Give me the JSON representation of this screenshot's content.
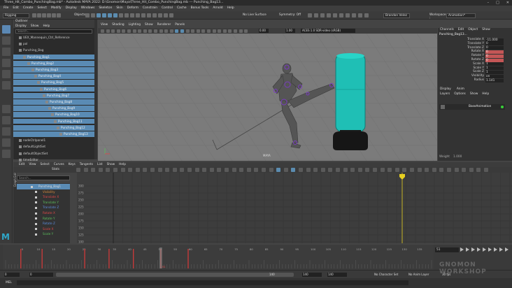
{
  "window": {
    "title": "Three_Hit_Combo_PunchingBag.mb* - Autodesk MAYA 2022: D:\\Gnomon\\Maya\\Three_Hit_Combo_PunchingBag.mb  ---  Punching_Bag13...",
    "buttons": [
      "–",
      "□",
      "✕"
    ]
  },
  "menubar": [
    "File",
    "Edit",
    "Create",
    "Select",
    "Modify",
    "Display",
    "Windows",
    "Skeleton",
    "Skin",
    "Deform",
    "Constrain",
    "Control",
    "Cache",
    "Bonus Tools",
    "Arnold",
    "Help"
  ],
  "statusline": {
    "mode": "Rigging",
    "objects_label": "Objects",
    "live_surface": "No Live Surface",
    "symmetry": "Symmetry: Off",
    "user": "Brandon Velez",
    "workspace_label": "Workspace :",
    "workspace": "Animation*"
  },
  "outliner": {
    "title": "Outliner",
    "menu": [
      "Display",
      "Show",
      "Help"
    ],
    "search_placeholder": "Search...",
    "rows": [
      {
        "label": "UEX_Mannequin_Ctrl_Reference",
        "indent": 8,
        "sel": false
      },
      {
        "label": "pol",
        "indent": 8,
        "sel": false
      },
      {
        "label": "Punching_Bag",
        "indent": 8,
        "sel": false
      },
      {
        "label": "Punching_Bag1",
        "indent": 14,
        "sel": true
      },
      {
        "label": "Punching_Bag2",
        "indent": 20,
        "sel": true
      },
      {
        "label": "Punching_Bag3",
        "indent": 26,
        "sel": true
      },
      {
        "label": "Punching_Bag4",
        "indent": 30,
        "sel": true
      },
      {
        "label": "Punching_Bag5",
        "indent": 34,
        "sel": true
      },
      {
        "label": "Punching_Bag6",
        "indent": 38,
        "sel": true
      },
      {
        "label": "Punching_Bag7",
        "indent": 42,
        "sel": true
      },
      {
        "label": "Punching_Bag8",
        "indent": 46,
        "sel": true
      },
      {
        "label": "Punching_Bag9",
        "indent": 50,
        "sel": true
      },
      {
        "label": "Punching_Bag10",
        "indent": 54,
        "sel": true
      },
      {
        "label": "Punching_Bag11",
        "indent": 58,
        "sel": true
      },
      {
        "label": "Punching_Bag12",
        "indent": 62,
        "sel": true
      },
      {
        "label": "Punching_Bag13",
        "indent": 66,
        "sel": true
      },
      {
        "label": "nodeCtrlpanel1",
        "indent": 8,
        "sel": false
      },
      {
        "label": "defaultLightSet",
        "indent": 8,
        "sel": false
      },
      {
        "label": "defaultObjectSet",
        "indent": 8,
        "sel": false
      },
      {
        "label": "timeEditor",
        "indent": 8,
        "sel": false
      }
    ]
  },
  "viewport": {
    "menu": [
      "View",
      "Shading",
      "Lighting",
      "Show",
      "Renderer",
      "Panels"
    ],
    "exposure": "0.00",
    "gamma": "1.00",
    "colorspace": "ACES 1.0 SDR-video (sRGB)",
    "camera_label": "persp",
    "axis_label": "MAYA"
  },
  "channelbox": {
    "tabs": [
      "Channels",
      "Edit",
      "Object",
      "Show"
    ],
    "object": "Punching_Bag13...",
    "channels": [
      {
        "label": "Translate X",
        "value": "-11.000",
        "red": false
      },
      {
        "label": "Translate Y",
        "value": "0",
        "red": false
      },
      {
        "label": "Translate Z",
        "value": "0",
        "red": false
      },
      {
        "label": "Rotate X",
        "value": "0",
        "red": true
      },
      {
        "label": "Rotate Y",
        "value": "0",
        "red": true
      },
      {
        "label": "Rotate Z",
        "value": "0",
        "red": true
      },
      {
        "label": "Scale X",
        "value": "1",
        "red": false
      },
      {
        "label": "Scale Y",
        "value": "1",
        "red": false
      },
      {
        "label": "Scale Z",
        "value": "1",
        "red": false
      },
      {
        "label": "Visibility",
        "value": "on",
        "red": false
      },
      {
        "label": "Radius",
        "value": "1.141",
        "red": false
      }
    ],
    "layer_tabs": [
      "Display",
      "Anim"
    ],
    "layer_menu": [
      "Layers",
      "Options",
      "Show",
      "Help"
    ],
    "layer_name": "BaseAnimation",
    "weight_label": "Weight",
    "weight_value": "1.000"
  },
  "graph_editor": {
    "menu": [
      "Edit",
      "View",
      "Select",
      "Curves",
      "Keys",
      "Tangents",
      "List",
      "Show",
      "Help"
    ],
    "stats_label": "Stats",
    "panel_label": "Graph Editor",
    "search_placeholder": "Search...",
    "list": [
      {
        "label": "Punching_Bag1",
        "color": "#dddddd",
        "sel": true
      },
      {
        "label": "Visibility",
        "color": "#dd8a3a",
        "sel": false
      },
      {
        "label": "Translate X",
        "color": "#e04747",
        "sel": false
      },
      {
        "label": "Translate Y",
        "color": "#5cc05c",
        "sel": false
      },
      {
        "label": "Translate Z",
        "color": "#5b8cdb",
        "sel": false
      },
      {
        "label": "Rotate X",
        "color": "#e04747",
        "sel": false
      },
      {
        "label": "Rotate Y",
        "color": "#5cc05c",
        "sel": false
      },
      {
        "label": "Rotate Z",
        "color": "#5b8cdb",
        "sel": false
      },
      {
        "label": "Scale X",
        "color": "#e04747",
        "sel": false
      },
      {
        "label": "Scale Y",
        "color": "#5cc05c",
        "sel": false
      }
    ],
    "y_ticks": [
      "300",
      "275",
      "250",
      "225",
      "200",
      "175",
      "150",
      "125",
      "100"
    ],
    "current_frame": "51"
  },
  "timeline": {
    "current_frame": "51",
    "frame_display": "51",
    "ticks": [
      "5",
      "10",
      "15",
      "20",
      "25",
      "30",
      "35",
      "40",
      "45",
      "50",
      "55",
      "60",
      "65",
      "70",
      "75",
      "80",
      "85",
      "90",
      "95",
      "100",
      "105",
      "110",
      "115",
      "120",
      "125",
      "130",
      "135"
    ],
    "key_frames": [
      5,
      12,
      26,
      34,
      42,
      51,
      60
    ]
  },
  "rangebar": {
    "start": "0",
    "range_start": "0",
    "range_end": "140",
    "end": "140",
    "end2": "140",
    "character": "No Character Set",
    "anim_layer": "No Anim Layer",
    "fps": "30 fps"
  },
  "cmdline": {
    "lang": "MEL"
  },
  "watermark": "GNOMON WORKSHOP"
}
